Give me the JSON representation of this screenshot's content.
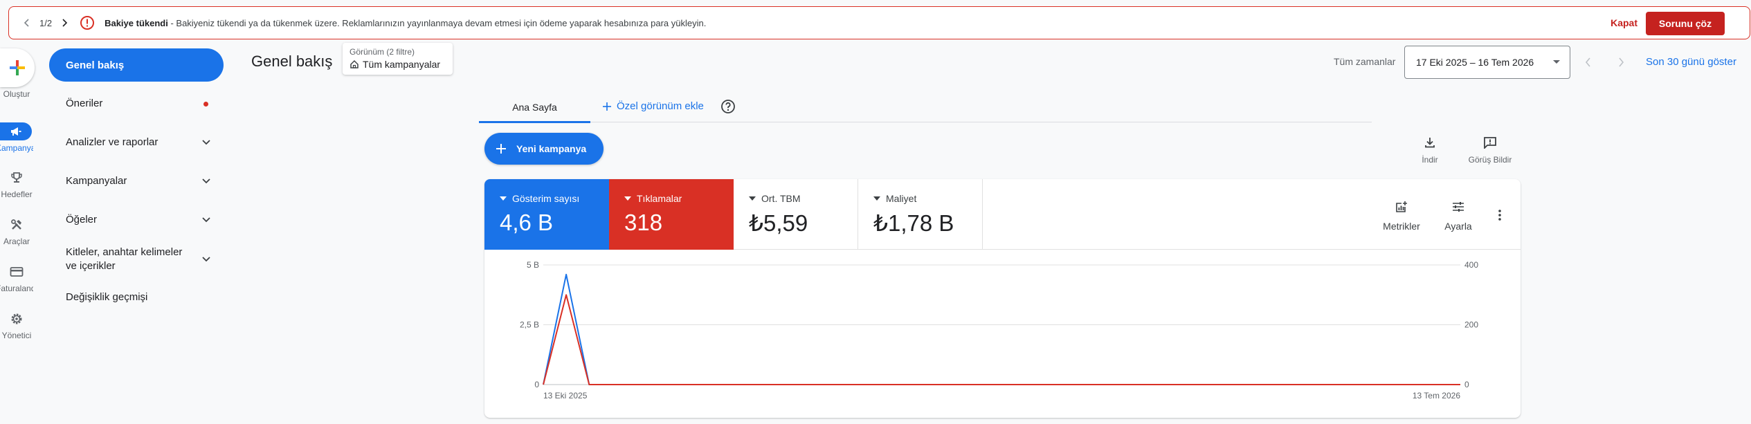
{
  "banner": {
    "pager_count": "1/2",
    "title": "Bakiye tükendi",
    "message": " - Bakiyeniz tükendi ya da tükenmek üzere. Reklamlarınızın yayınlanmaya devam etmesi için ödeme yaparak hesabınıza para yükleyin.",
    "close_label": "Kapat",
    "fix_label": "Sorunu çöz"
  },
  "rail": {
    "create_label": "Oluştur",
    "items": [
      {
        "label": "Kampanyalar",
        "icon": "megaphone-icon",
        "active": true
      },
      {
        "label": "Hedefler",
        "icon": "trophy-icon",
        "active": false
      },
      {
        "label": "Araçlar",
        "icon": "tools-icon",
        "active": false
      },
      {
        "label": "Faturalandırma",
        "icon": "credit-card-icon",
        "active": false
      },
      {
        "label": "Yönetici",
        "icon": "gear-icon",
        "active": false
      }
    ]
  },
  "nav": {
    "active": "Genel bakış",
    "items": [
      {
        "label": "Öneriler"
      },
      {
        "label": "Analizler ve raporlar"
      },
      {
        "label": "Kampanyalar"
      },
      {
        "label": "Öğeler"
      },
      {
        "label": "Kitleler, anahtar kelimeler ve içerikler"
      },
      {
        "label": "Değişiklik geçmişi"
      }
    ]
  },
  "header": {
    "title": "Genel bakış",
    "view_small": "Görünüm (2 filtre)",
    "view_main": "Tüm kampanyalar",
    "all_time": "Tüm zamanlar",
    "date_range": "17 Eki 2025 – 16 Tem 2026",
    "last30": "Son 30 günü göster"
  },
  "tabs": {
    "home": "Ana Sayfa",
    "add_view": "Özel görünüm ekle"
  },
  "actions": {
    "new_campaign": "Yeni kampanya",
    "download": "İndir",
    "feedback": "Görüş Bildir"
  },
  "metrics": [
    {
      "label": "Gösterim sayısı",
      "value": "4,6 B",
      "color": "#1a73e8"
    },
    {
      "label": "Tıklamalar",
      "value": "318",
      "color": "#d93025"
    },
    {
      "label": "Ort. TBM",
      "value": "₺5,59"
    },
    {
      "label": "Maliyet",
      "value": "₺1,78 B"
    }
  ],
  "card_tools": {
    "metrics": "Metrikler",
    "adjust": "Ayarla"
  },
  "chart_data": {
    "type": "line",
    "x_labels": [
      "13 Eki 2025",
      "13 Tem 2026"
    ],
    "left_axis": {
      "ticks": [
        "0",
        "2,5 B",
        "5 B"
      ],
      "max": 5000
    },
    "right_axis": {
      "ticks": [
        "0",
        "200",
        "400"
      ],
      "max": 400
    },
    "series": [
      {
        "name": "Gösterim sayısı",
        "axis": "left",
        "color": "#1a73e8",
        "values": [
          0,
          4600,
          0,
          0
        ]
      },
      {
        "name": "Tıklamalar",
        "axis": "right",
        "color": "#d93025",
        "values": [
          0,
          300,
          0,
          0
        ]
      }
    ],
    "x_positions": [
      0,
      0.025,
      0.05,
      1
    ],
    "grid": true
  }
}
